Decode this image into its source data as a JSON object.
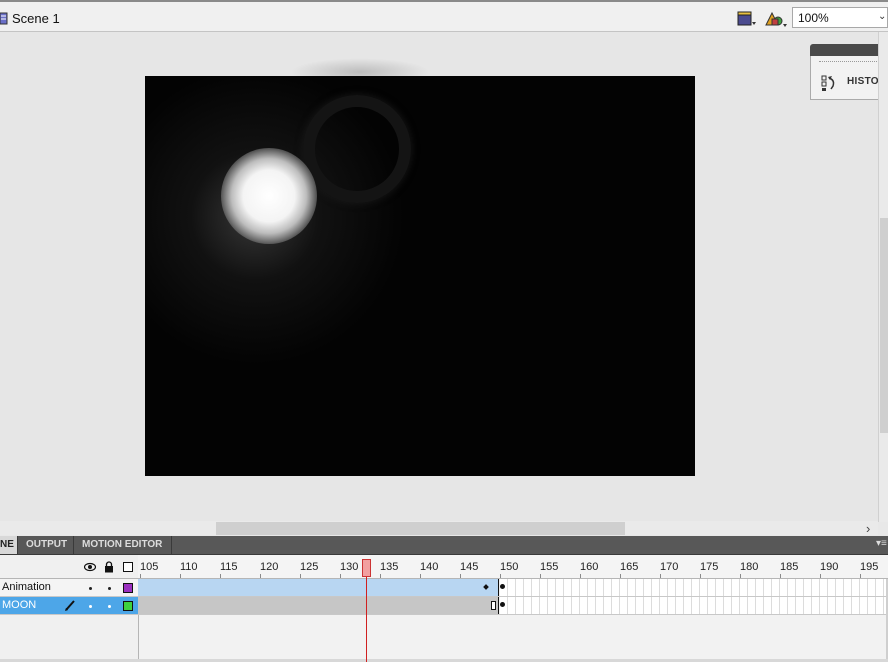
{
  "editbar": {
    "scene_name": "Scene 1",
    "edit_scene_icon": "clapperboard-icon",
    "edit_symbol_icon": "symbols-icon",
    "zoom_value": "100%"
  },
  "history_panel": {
    "label": "HISTORY",
    "icon": "history-icon"
  },
  "tabs": {
    "timeline": "NE",
    "output": "OUTPUT",
    "motion_editor": "MOTION EDITOR"
  },
  "timeline": {
    "current_frame": 133,
    "ruler_labels": [
      "105",
      "110",
      "115",
      "120",
      "125",
      "130",
      "135",
      "140",
      "145",
      "150",
      "155",
      "160",
      "165",
      "170",
      "175",
      "180",
      "185",
      "190",
      "195"
    ],
    "layers": [
      {
        "name": "Animation",
        "color": "#9b30c0",
        "selected": false
      },
      {
        "name": "MOON",
        "color": "#3ed23e",
        "selected": true
      }
    ]
  },
  "colors": {
    "stage": "#030303",
    "selection": "#4da6e8",
    "tween_span": "#b8d6f2",
    "playhead": "#d02020"
  }
}
